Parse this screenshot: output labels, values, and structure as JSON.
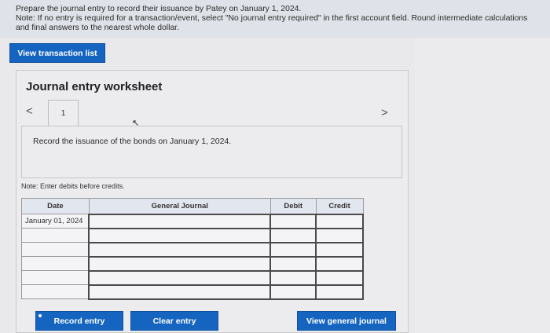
{
  "instructions": {
    "line1": "Prepare the journal entry to record their issuance by Patey on January 1, 2024.",
    "line2": "Note: If no entry is required for a transaction/event, select \"No journal entry required\" in the first account field. Round intermediate calculations and final answers to the nearest whole dollar."
  },
  "buttons": {
    "view_transaction_list": "View transaction list",
    "record_entry": "Record entry",
    "clear_entry": "Clear entry",
    "view_general_journal": "View general journal"
  },
  "worksheet": {
    "title": "Journal entry worksheet",
    "prev_arrow": "<",
    "next_arrow": ">",
    "tab_number": "1",
    "description": "Record the issuance of the bonds on January 1, 2024.",
    "note": "Note: Enter debits before credits."
  },
  "journal_table": {
    "headers": {
      "date": "Date",
      "general_journal": "General Journal",
      "debit": "Debit",
      "credit": "Credit"
    },
    "rows": [
      {
        "date": "January 01, 2024"
      },
      {
        "date": ""
      },
      {
        "date": ""
      },
      {
        "date": ""
      },
      {
        "date": ""
      },
      {
        "date": ""
      }
    ]
  },
  "colors": {
    "button_blue": "#1565c0",
    "header_bg": "#e2e6ee"
  }
}
